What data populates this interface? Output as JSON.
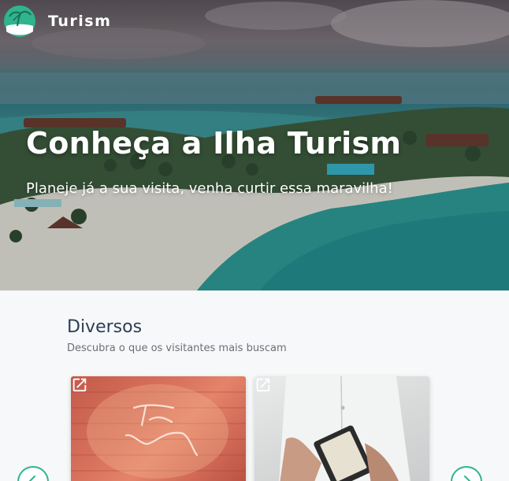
{
  "header": {
    "brand_name": "Turism",
    "logo_icon": "island-palm-logo-icon"
  },
  "hero": {
    "title": "Conheça a Ilha Turism",
    "subtitle": "Planeje já a sua visita, venha curtir essa maravilha!"
  },
  "section": {
    "title": "Diversos",
    "subtitle": "Descubra o que os visitantes mais buscam"
  },
  "cards": [
    {
      "name": "treat-yourself-card",
      "image_text": "Treat Yourself",
      "icon": "open-external-icon"
    },
    {
      "name": "waiter-card",
      "icon": "open-external-icon"
    }
  ],
  "carousel": {
    "prev_icon": "chevron-left-icon",
    "next_icon": "chevron-right-icon"
  },
  "colors": {
    "accent": "#2fb48e",
    "section_title": "#2b3f57",
    "page_bg": "#f7f8f9"
  }
}
